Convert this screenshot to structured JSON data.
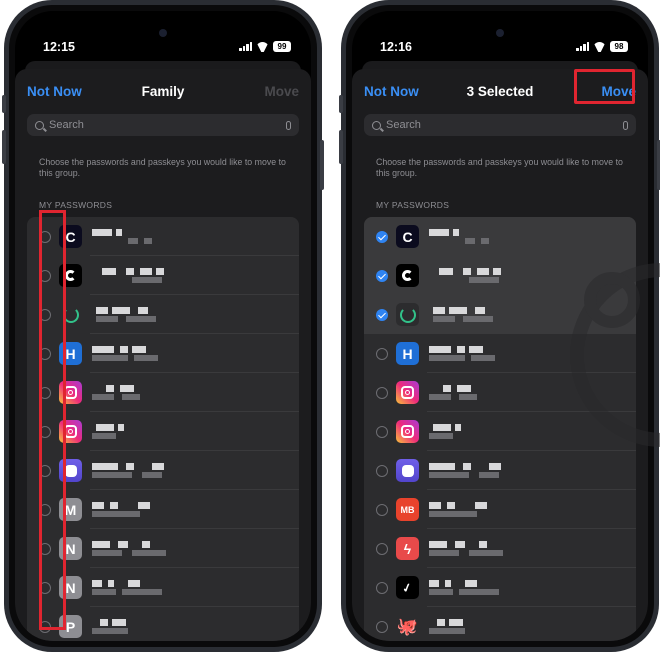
{
  "phones": [
    {
      "status": {
        "time": "12:15",
        "battery": "99"
      },
      "nav": {
        "left": "Not Now",
        "title": "Family",
        "right": "Move",
        "right_enabled": false
      },
      "search": {
        "placeholder": "Search"
      },
      "description": "Choose the passwords and passkeys you would like to move to this group.",
      "section_header": "MY PASSWORDS",
      "rows": [
        {
          "icon": "coinbase-c",
          "glyph": "C",
          "checked": false
        },
        {
          "icon": "app-icon-swirl",
          "glyph": "",
          "checked": false
        },
        {
          "icon": "app-icon-green-ring",
          "glyph": "",
          "checked": false
        },
        {
          "icon": "app-icon-h",
          "glyph": "H",
          "checked": false
        },
        {
          "icon": "instagram",
          "glyph": "",
          "checked": false
        },
        {
          "icon": "instagram",
          "glyph": "",
          "checked": false
        },
        {
          "icon": "mastodon",
          "glyph": "",
          "checked": false
        },
        {
          "icon": "letter-m",
          "glyph": "M",
          "checked": false
        },
        {
          "icon": "letter-n",
          "glyph": "N",
          "checked": false
        },
        {
          "icon": "letter-n",
          "glyph": "N",
          "checked": false
        },
        {
          "icon": "letter-p",
          "glyph": "P",
          "checked": false
        }
      ]
    },
    {
      "status": {
        "time": "12:16",
        "battery": "98"
      },
      "nav": {
        "left": "Not Now",
        "title": "3 Selected",
        "right": "Move",
        "right_enabled": true
      },
      "search": {
        "placeholder": "Search"
      },
      "description": "Choose the passwords and passkeys you would like to move to this group.",
      "section_header": "MY PASSWORDS",
      "rows": [
        {
          "icon": "coinbase-c",
          "glyph": "C",
          "checked": true
        },
        {
          "icon": "app-icon-swirl",
          "glyph": "",
          "checked": true
        },
        {
          "icon": "app-icon-green-ring",
          "glyph": "",
          "checked": true
        },
        {
          "icon": "app-icon-h",
          "glyph": "H",
          "checked": false
        },
        {
          "icon": "instagram",
          "glyph": "",
          "checked": false
        },
        {
          "icon": "instagram",
          "glyph": "",
          "checked": false
        },
        {
          "icon": "mastodon",
          "glyph": "",
          "checked": false
        },
        {
          "icon": "mb-badge",
          "glyph": "MB",
          "checked": false
        },
        {
          "icon": "app-icon-red-n",
          "glyph": "",
          "checked": false
        },
        {
          "icon": "nike",
          "glyph": "",
          "checked": false
        },
        {
          "icon": "octopus",
          "glyph": "🐙",
          "checked": false
        }
      ]
    }
  ],
  "annotations": {
    "highlight_color": "#e02530",
    "accent_color": "#3a8ff5"
  }
}
